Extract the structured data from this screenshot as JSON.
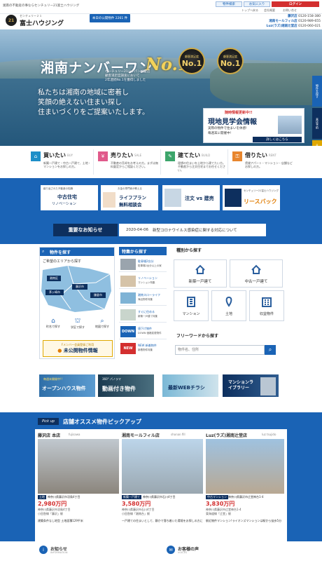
{
  "header": {
    "tagline": "湘南の不動産の事ならセンチュリー21富士ハウジング",
    "utility": [
      "物件検索",
      "お気に入り",
      "ログイン"
    ],
    "sub_links": [
      "トップへ戻る",
      "会社概要",
      "お問い合せ"
    ],
    "logo_top": "センチュリー２１",
    "logo_name": "富士ハウジング",
    "public_count": "本日の公開物件 2261 件",
    "phones": [
      {
        "label": "藤沢店",
        "number": "0120-158-380"
      },
      {
        "label": "湘南モールフィル店",
        "number": "0120-989-655"
      },
      {
        "label": "Luz(ラズ)湘南辻堂店",
        "number": "0120-060-021"
      }
    ]
  },
  "hero": {
    "headline_a": "湘南ナンバーワン",
    "headline_b": "No.1",
    "medal1": {
      "top": "顧客満足度",
      "big": "No.1"
    },
    "medal2": {
      "top": "顧客満足度",
      "big": "No.1"
    },
    "sub1": "センチュリー21ジャパン加盟店",
    "sub2": "顧客満足度調査において",
    "sub3": "2年連続No.1を獲得しました",
    "slogan": [
      "私たちは湘南の地域に密着し",
      "笑顔の絶えない住まい探し",
      "住まいづくりをご提案いたします。"
    ],
    "side_tabs": [
      "物件を探す",
      "来店予約"
    ],
    "banner": {
      "top": "随時情報更新中!!",
      "title": "現地見学会情報",
      "line1": "実際の物件で住まいを体感!",
      "line2": "毎週末に開催中!",
      "link": "詳しくはこちら"
    }
  },
  "services": [
    {
      "title": "買いたい",
      "en": "BUY",
      "desc": "新築一戸建て・中古一戸建て、土地・マンションをお探しの方。"
    },
    {
      "title": "売りたい",
      "en": "SALE",
      "desc": "不動産の売却をお考えの方。まずは無料査定からご相談ください。"
    },
    {
      "title": "建てたい",
      "en": "BUILD",
      "desc": "理想の住まいを土地から建てたい方。不動産から注文住宅までお任せください。"
    },
    {
      "title": "借りたい",
      "en": "RENT",
      "desc": "賃貸アパート・マンション・店舗などお探しの方。"
    }
  ],
  "promos": [
    {
      "top": "繰り返された不動産の知識",
      "title": "中古住宅",
      "sub": "リノベーション"
    },
    {
      "top": "お金の専門家が教える",
      "title": "ライフプラン",
      "sub": "無料相談会"
    },
    {
      "top": "",
      "title": "注文 vs 建売",
      "sub": ""
    },
    {
      "top": "センチュリー21富士ハウジング",
      "title": "リースバック",
      "sub": ""
    }
  ],
  "news": {
    "label": "重要なお知らせ",
    "date": "2020-04-06",
    "text": "新型コロナウイルス感染症に関する対応について"
  },
  "area_search": {
    "title": "物件を探す",
    "subtitle": "ご希望のエリアから探す",
    "areas": [
      "湘南区",
      "藤沢市",
      "茅ヶ崎市",
      "鎌倉市"
    ],
    "buttons": [
      "町名で探す",
      "学区で探す",
      "地図で探す"
    ],
    "member_small": "Fメンバー会員登録ご利用",
    "member": "未公開物件情報"
  },
  "features": {
    "title": "特集から探す",
    "items": [
      {
        "title": "駐車場2台分",
        "desc": "駐車場2台分以上の家"
      },
      {
        "title": "リノベーション",
        "desc": "マンション特集"
      },
      {
        "title": "湘南スローライフ",
        "desc": "海近物件特集"
      },
      {
        "title": "すぐに住める",
        "desc": "新築一戸建て特集"
      },
      {
        "title": "値下げ物件",
        "desc": "DOWN 価格変更物件"
      },
      {
        "title": "NEW 新着物件",
        "desc": "新着物件特集"
      }
    ]
  },
  "type_search": {
    "title": "種別から探す",
    "types": [
      "新築一戸建て",
      "中古一戸建て",
      "マンション",
      "土地",
      "収益物件"
    ],
    "freeword_title": "フリーワードから探す",
    "placeholder": "物件名、住所"
  },
  "mid_banners": [
    {
      "top": "毎週末開催中!!",
      "title": "オープンハウス物件"
    },
    {
      "top": "360° パノラマ",
      "title": "動画付き物件"
    },
    {
      "top": "",
      "title": "最新WEBチラシ"
    },
    {
      "top": "",
      "title": "マンションライブラリー"
    }
  ],
  "pickup": {
    "tag": "Pick up",
    "title": "店舗オススメ物件ピックアップ",
    "shops": [
      {
        "name": "藤沢店 本店",
        "en": "fujisawa",
        "type": "土地",
        "addr": "神奈川県藤沢市羽鳥4丁目",
        "price": "2,980万円",
        "detail": "神奈川県藤沢市羽鳥4丁目",
        "station": "小田急線「藤沢」駅",
        "comment": "建築条件なし地型 土地面積129平米"
      },
      {
        "name": "湘南モールフィル店",
        "en": "shonan fill",
        "type": "新築一戸建て",
        "addr": "神奈川県藤沢市石川4丁目",
        "price": "3,580万円",
        "detail": "神奈川県藤沢市石川4丁目",
        "station": "小田急線「湘南台」駅",
        "comment": "一戸建ての住まいとして、静かで落ち着いた環境をお探しの方に"
      },
      {
        "name": "Luz(ラズ)湘南辻堂店",
        "en": "luz tsujido",
        "type": "中古マンション",
        "addr": "神奈川県藤沢市辻堂神台1-4",
        "price": "3,830万円",
        "detail": "神奈川県藤沢市辻堂神台1-4",
        "station": "東海道線「辻堂」駅",
        "comment": "駅近物件マンション!ライオンズマンションは駅から徒歩5分"
      }
    ]
  },
  "footer_links": [
    {
      "title": "お知らせ",
      "en": "INFORMATION"
    },
    {
      "title": "お客様の声",
      "en": "VOICES"
    }
  ],
  "colors": {
    "blue": "#1a63b5",
    "navy": "#0d2f5e",
    "orange": "#e07b00",
    "red": "#d32f2f"
  }
}
